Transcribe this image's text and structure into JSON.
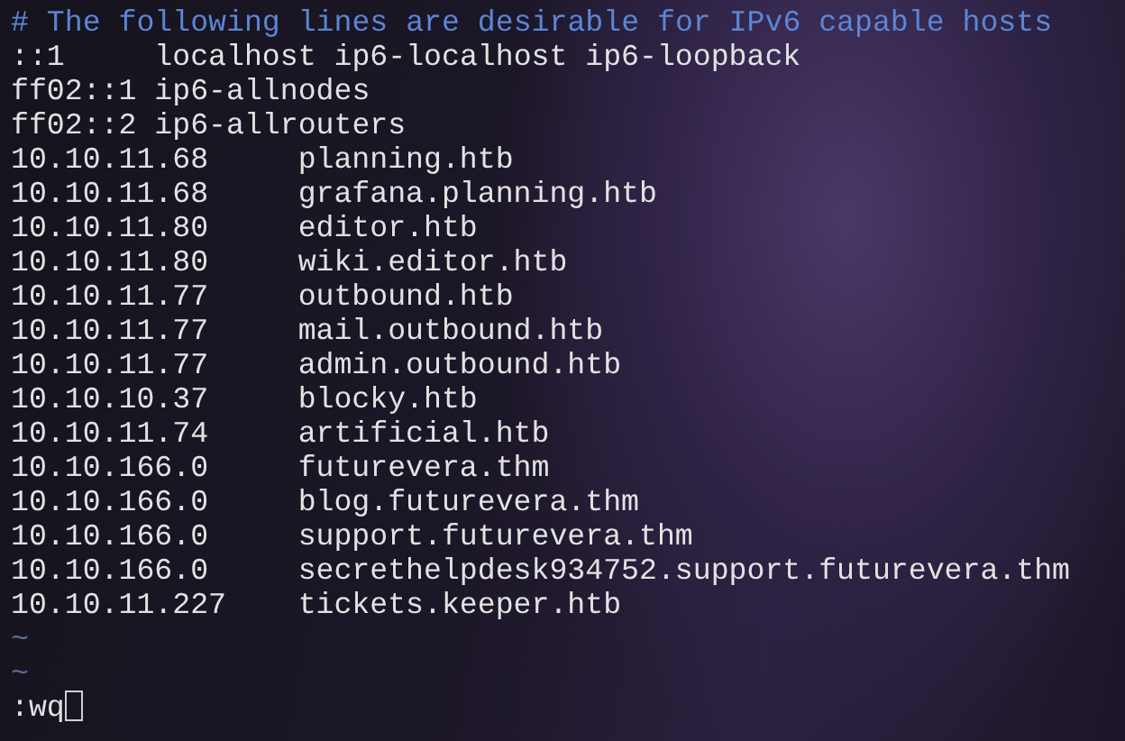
{
  "editor": {
    "comment": "# The following lines are desirable for IPv6 capable hosts",
    "lines": [
      {
        "address": "::1",
        "hostnames": "localhost ip6-localhost ip6-loopback",
        "kind": "tabbed"
      },
      {
        "address": "ff02::1",
        "hostnames": "ip6-allnodes",
        "kind": "spaced"
      },
      {
        "address": "ff02::2",
        "hostnames": "ip6-allrouters",
        "kind": "spaced"
      },
      {
        "address": "10.10.11.68",
        "hostnames": "planning.htb",
        "kind": "tabbed"
      },
      {
        "address": "10.10.11.68",
        "hostnames": "grafana.planning.htb",
        "kind": "tabbed"
      },
      {
        "address": "10.10.11.80",
        "hostnames": "editor.htb",
        "kind": "tabbed"
      },
      {
        "address": "10.10.11.80",
        "hostnames": "wiki.editor.htb",
        "kind": "tabbed"
      },
      {
        "address": "10.10.11.77",
        "hostnames": "outbound.htb",
        "kind": "tabbed"
      },
      {
        "address": "10.10.11.77",
        "hostnames": "mail.outbound.htb",
        "kind": "tabbed"
      },
      {
        "address": "10.10.11.77",
        "hostnames": "admin.outbound.htb",
        "kind": "tabbed"
      },
      {
        "address": "10.10.10.37",
        "hostnames": "blocky.htb",
        "kind": "tabbed"
      },
      {
        "address": "10.10.11.74",
        "hostnames": "artificial.htb",
        "kind": "tabbed"
      },
      {
        "address": "10.10.166.0",
        "hostnames": "futurevera.thm",
        "kind": "tabbed"
      },
      {
        "address": "10.10.166.0",
        "hostnames": "blog.futurevera.thm",
        "kind": "tabbed"
      },
      {
        "address": "10.10.166.0",
        "hostnames": "support.futurevera.thm",
        "kind": "tabbed"
      },
      {
        "address": "10.10.166.0",
        "hostnames": "secrethelpdesk934752.support.futurevera.thm",
        "kind": "tabbed"
      },
      {
        "address": "10.10.11.227",
        "hostnames": "tickets.keeper.htb",
        "kind": "tabbed"
      }
    ],
    "empty_markers": [
      "~",
      "~"
    ],
    "command_line": ":wq"
  }
}
